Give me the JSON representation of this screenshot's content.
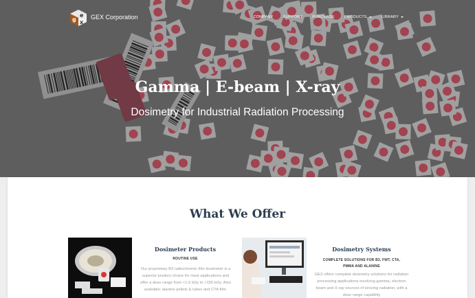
{
  "brand": {
    "name": "GEX Corporation",
    "logo_letters": [
      "g",
      "e",
      "x"
    ]
  },
  "nav": {
    "items": [
      {
        "label": "COMPANY"
      },
      {
        "label": "SUPPORT"
      },
      {
        "label": "PURCHASE"
      },
      {
        "label": "PRODUCTS"
      },
      {
        "label": "LIBRARY"
      }
    ]
  },
  "hero": {
    "title": "Gamma | E-beam | X-ray",
    "subtitle": "Dosimetry for Industrial Radiation Processing"
  },
  "offer": {
    "heading": "What We Offer",
    "products": [
      {
        "title": "Dosimeter Products",
        "subtitle": "ROUTINE USE",
        "description": "Our proprietary B3 radiochromic film dosimeter is a superior product choice for most applications and offer a dose range from <1.0 kGy to >150 kGy. Also available: alanine pellets & tubes and CTA film."
      },
      {
        "title": "Dosimetry Systems",
        "subtitle": "COMPLETE SOLUTIONS FOR B3, FWT, CTA, PMMA AND ALANINE",
        "description": "GEX offers complete dosimetry solutions for radiation processing applications involving gamma, electron beam and X-ray sources of ionizing radiation, with a dose range capability"
      }
    ]
  },
  "colors": {
    "heading": "#2c3e50",
    "dosimeter_red": "#d8475b",
    "muted_text": "#999999"
  }
}
